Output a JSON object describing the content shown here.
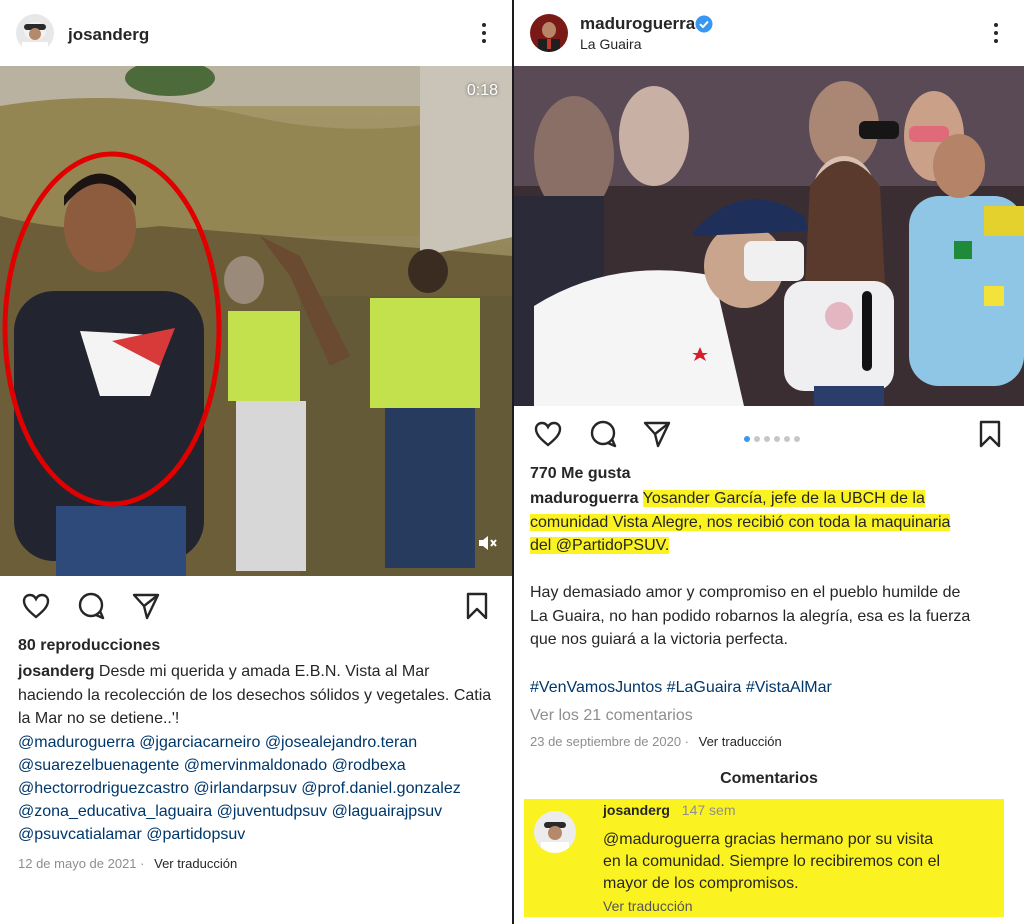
{
  "left_post": {
    "username": "josanderg",
    "video_time": "0:18",
    "views": "80 reproducciones",
    "caption_user": "josanderg",
    "caption_text": "Desde mi querida y amada E.B.N. Vista al Mar haciendo la recolección de los desechos sólidos y vegetales. Catia la Mar no se detiene..'!",
    "mentions": [
      "@maduroguerra @jgarciacarneiro  @josealejandro.teran",
      "@suarezelbuenagente @mervinmaldonado @rodbexa",
      "@hectorrodriguezcastro @irlandarpsuv @prof.daniel.gonzalez",
      "@zona_educativa_laguaira @juventudpsuv @laguairajpsuv",
      "@psuvcatialamar @partidopsuv"
    ],
    "date": "12 de mayo de 2021",
    "translate": "Ver traducción"
  },
  "right_post": {
    "username": "maduroguerra",
    "location": "La Guaira",
    "likes": "770 Me gusta",
    "caption_user": "maduroguerra",
    "caption_lines": [
      "Yosander García, jefe de la UBCH de la",
      "comunidad Vista Alegre, nos recibió con toda la maquinaria",
      "del @PartidoPSUV."
    ],
    "paragraph_lines": [
      "Hay demasiado amor y compromiso en el pueblo humilde de",
      "La Guaira, no han podido robarnos la alegría, esa es la fuerza",
      "que nos guiará a la victoria perfecta."
    ],
    "hashtags": "#VenVamosJuntos #LaGuaira #VistaAlMar",
    "view_comments": "Ver los 21 comentarios",
    "date": "23 de septiembre de 2020",
    "translate": "Ver traducción",
    "comments_title": "Comentarios",
    "comment": {
      "username": "josanderg",
      "age": "147 sem",
      "lines": [
        "@maduroguerra gracias hermano por su visita",
        "en la comunidad. Siempre lo recibiremos con el",
        "mayor de los compromisos."
      ],
      "translate": "Ver traducción"
    }
  },
  "icons": [
    "heart-icon",
    "comment-icon",
    "share-icon",
    "bookmark-icon",
    "more-icon",
    "verified-icon",
    "mute-icon"
  ],
  "colors": {
    "highlight": "#fbf321",
    "link": "#00376b",
    "verified": "#3897f0",
    "circle": "#e00000"
  }
}
